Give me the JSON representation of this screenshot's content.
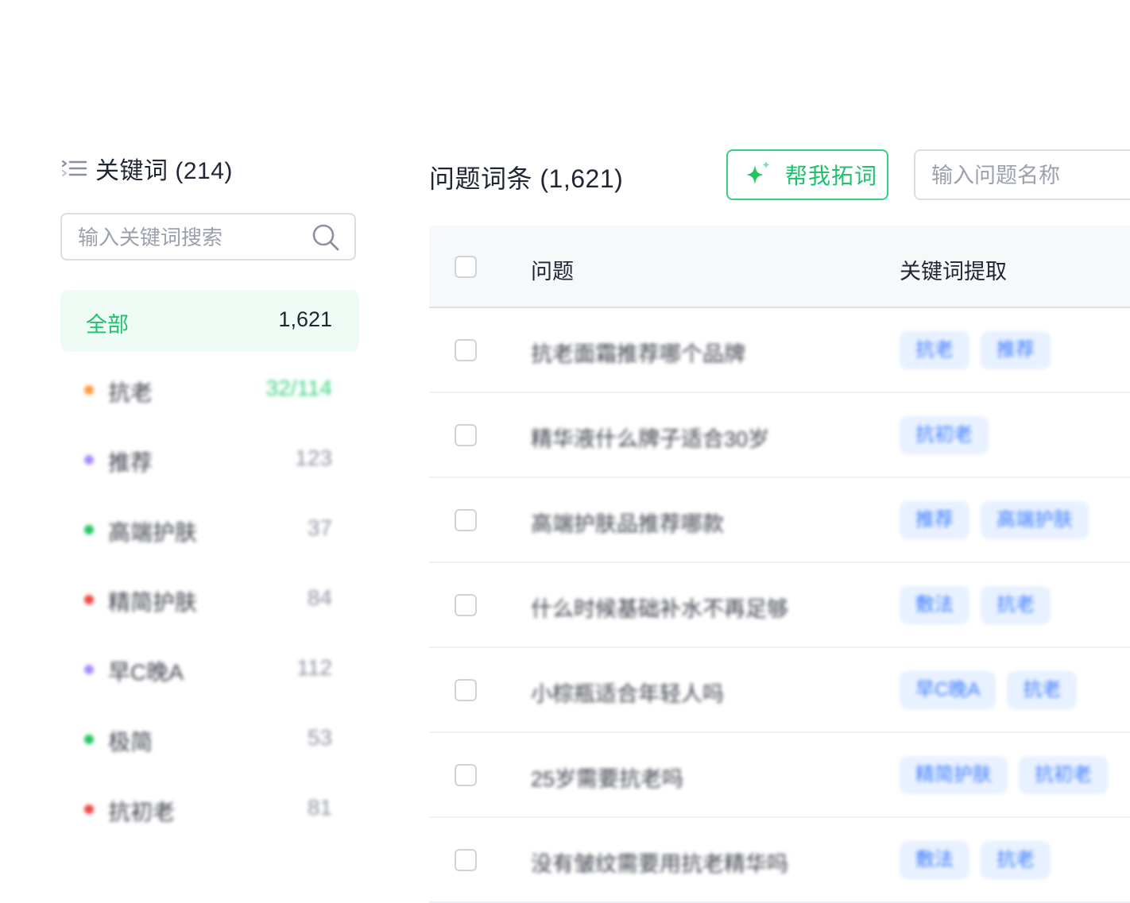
{
  "sidebar": {
    "title": "关键词 (214)",
    "search_placeholder": "输入关键词搜索",
    "all": {
      "label": "全部",
      "count": "1,621"
    },
    "keywords": [
      {
        "name": "抗老",
        "count": "32/114",
        "dot_color": "#ff9a3d",
        "count_color": "#3ad17e"
      },
      {
        "name": "推荐",
        "count": "123",
        "dot_color": "#a78bfa",
        "count_color": "#8d93a0"
      },
      {
        "name": "高端护肤",
        "count": "37",
        "dot_color": "#22c55e",
        "count_color": "#8d93a0"
      },
      {
        "name": "精简护肤",
        "count": "84",
        "dot_color": "#ef4444",
        "count_color": "#8d93a0"
      },
      {
        "name": "早C晚A",
        "count": "112",
        "dot_color": "#a78bfa",
        "count_color": "#8d93a0"
      },
      {
        "name": "极简",
        "count": "53",
        "dot_color": "#22c55e",
        "count_color": "#8d93a0"
      },
      {
        "name": "抗初老",
        "count": "81",
        "dot_color": "#ef4444",
        "count_color": "#8d93a0"
      }
    ]
  },
  "main": {
    "title": "问题词条 (1,621)",
    "expand_button": "帮我拓词",
    "search_placeholder": "输入问题名称",
    "table": {
      "col_question": "问题",
      "col_keywords": "关键词提取",
      "rows": [
        {
          "question": "抗老面霜推荐哪个品牌",
          "tags": [
            "抗老",
            "推荐"
          ]
        },
        {
          "question": "精华液什么牌子适合30岁",
          "tags": [
            "抗初老"
          ]
        },
        {
          "question": "高端护肤品推荐哪款",
          "tags": [
            "推荐",
            "高端护肤"
          ]
        },
        {
          "question": "什么时候基础补水不再足够",
          "tags": [
            "敷法",
            "抗老"
          ]
        },
        {
          "question": "小棕瓶适合年轻人吗",
          "tags": [
            "早C晚A",
            "抗老"
          ]
        },
        {
          "question": "25岁需要抗老吗",
          "tags": [
            "精简护肤",
            "抗初老"
          ]
        },
        {
          "question": "没有皱纹需要用抗老精华吗",
          "tags": [
            "敷法",
            "抗老"
          ]
        }
      ]
    }
  },
  "colors": {
    "accent_green": "#1fc16b",
    "tag_bg": "#e8f1ff",
    "tag_text": "#3d7eff"
  }
}
